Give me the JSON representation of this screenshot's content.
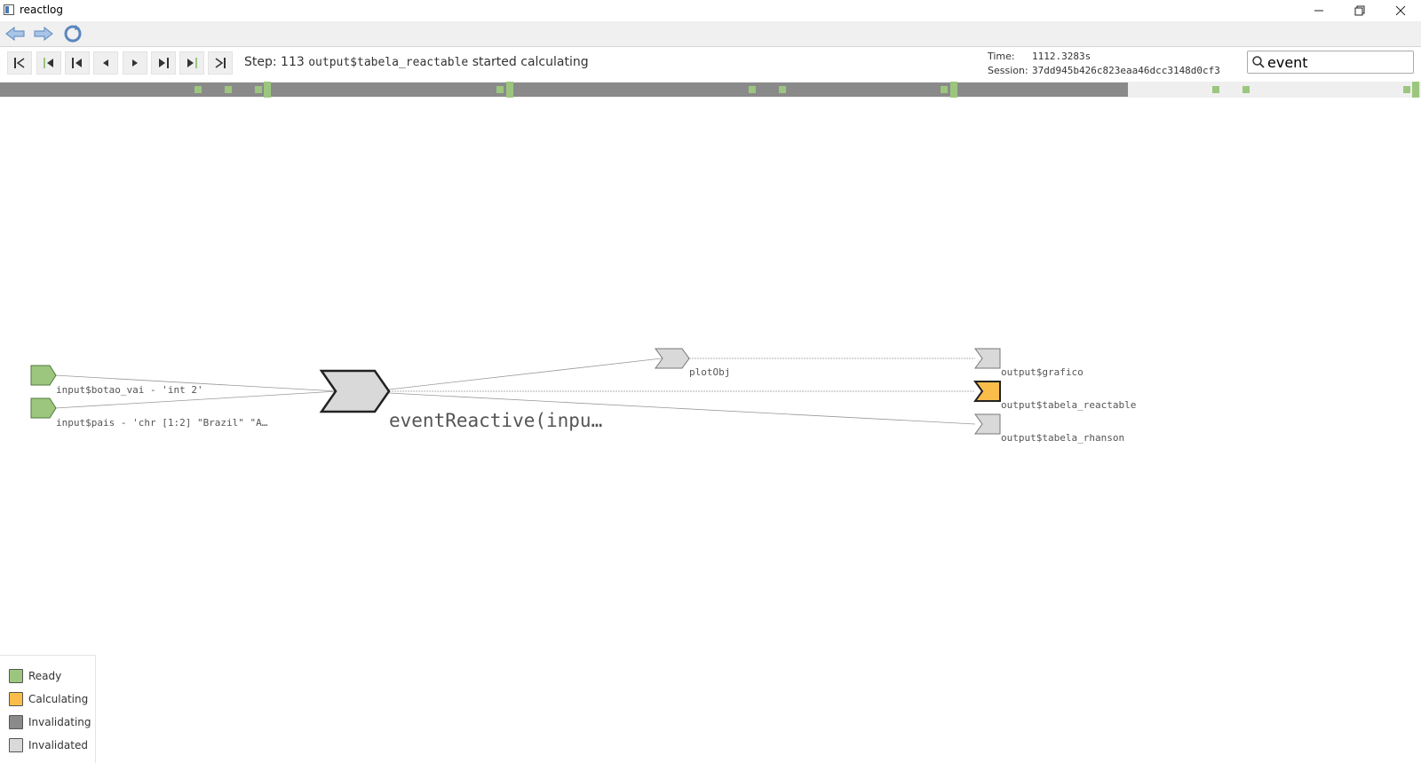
{
  "window": {
    "title": "reactlog"
  },
  "controls": {
    "step_prefix": "Step: 113",
    "step_node": "output$tabela_reactable",
    "step_action": "started calculating"
  },
  "meta": {
    "time_label": "Time:",
    "time_value": "1112.3283s",
    "session_label": "Session:",
    "session_value": "37dd945b426c823eaa46dcc3148d0cf3"
  },
  "search": {
    "value": "event"
  },
  "timeline": {
    "progress": 0.794
  },
  "graph": {
    "nodes": {
      "input_botao_vai": "input$botao_vai - 'int 2'",
      "input_pais": "input$pais - 'chr [1:2] \"Brazil\" \"A…",
      "event_reactive": "eventReactive(inpu…",
      "plot_obj": "plotObj",
      "output_grafico": "output$grafico",
      "output_tabela_reactable": "output$tabela_reactable",
      "output_tabela_rhanson": "output$tabela_rhanson"
    }
  },
  "legend": {
    "items": [
      "Ready",
      "Calculating",
      "Invalidating",
      "Invalidated"
    ]
  },
  "colors": {
    "ready": "#9cc67e",
    "calculating": "#fbbd4a",
    "invalidating": "#8a8a8a",
    "invalidated": "#d9d9d9"
  }
}
